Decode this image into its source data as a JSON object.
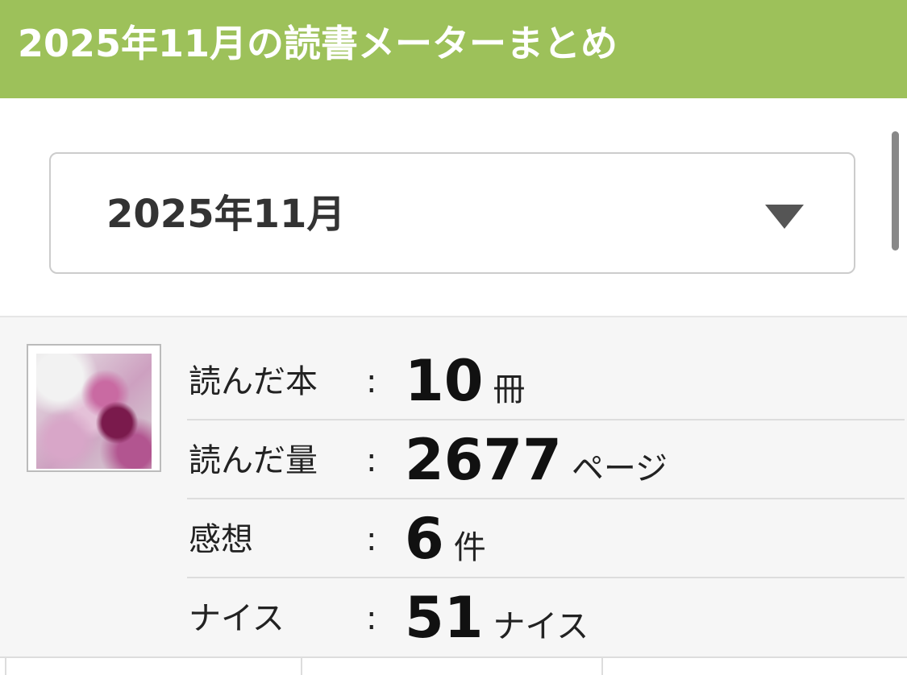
{
  "header": {
    "title": "2025年11月の読書メーターまとめ"
  },
  "month_selector": {
    "value": "2025年11月"
  },
  "summary": {
    "stats": [
      {
        "label": "読んだ本",
        "colon": ":",
        "value": "10",
        "unit": "冊"
      },
      {
        "label": "読んだ量",
        "colon": ":",
        "value": "2677",
        "unit": "ページ"
      },
      {
        "label": "感想",
        "colon": ":",
        "value": "6",
        "unit": "件"
      },
      {
        "label": "ナイス",
        "colon": ":",
        "value": "51",
        "unit": "ナイス"
      }
    ]
  },
  "colors": {
    "header_bg": "#9dc15a",
    "summary_bg": "#f6f6f6"
  },
  "icons": {
    "select_arrow": "chevron-down-icon"
  }
}
